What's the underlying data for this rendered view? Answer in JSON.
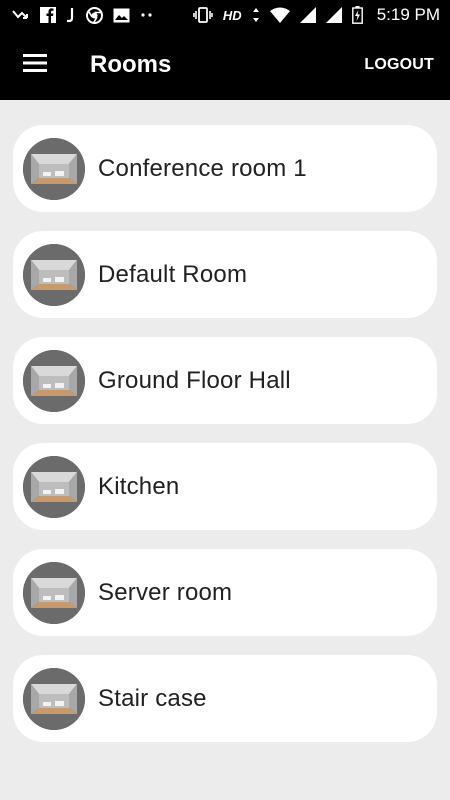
{
  "status_bar": {
    "time": "5:19 PM",
    "network_label": "HD",
    "icons": [
      "missed-call-icon",
      "facebook-icon",
      "j-app-icon",
      "chrome-icon",
      "gallery-icon",
      "more-dots-icon",
      "vibrate-icon",
      "data-arrows-icon",
      "wifi-icon",
      "signal-icon",
      "signal-icon-2",
      "battery-charging-icon"
    ]
  },
  "app_bar": {
    "title": "Rooms",
    "logout_label": "LOGOUT",
    "menu_icon": "hamburger-menu-icon"
  },
  "rooms": [
    {
      "name": "Conference room 1"
    },
    {
      "name": "Default Room"
    },
    {
      "name": "Ground Floor Hall"
    },
    {
      "name": "Kitchen"
    },
    {
      "name": "Server room"
    },
    {
      "name": "Stair case"
    }
  ],
  "colors": {
    "app_bar": "#000000",
    "background": "#ececec",
    "card": "#ffffff",
    "avatar": "#6b6b6b"
  }
}
